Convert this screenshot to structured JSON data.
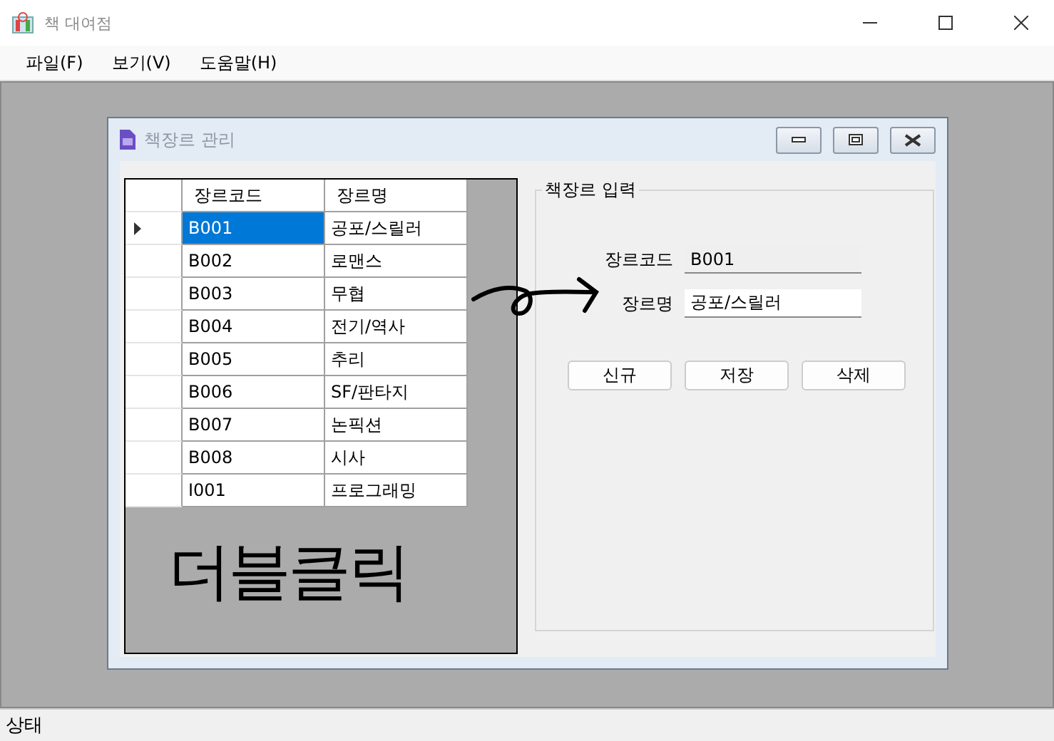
{
  "window": {
    "title": "책 대여점"
  },
  "menu": [
    "파일(F)",
    "보기(V)",
    "도움말(H)"
  ],
  "child_window": {
    "title": "책장르 관리"
  },
  "grid": {
    "columns": [
      "장르코드",
      "장르명"
    ],
    "rows": [
      {
        "cells": [
          "B001",
          "공포/스릴러"
        ],
        "selected": true
      },
      {
        "cells": [
          "B002",
          "로맨스"
        ],
        "selected": false
      },
      {
        "cells": [
          "B003",
          "무협"
        ],
        "selected": false
      },
      {
        "cells": [
          "B004",
          "전기/역사"
        ],
        "selected": false
      },
      {
        "cells": [
          "B005",
          "추리"
        ],
        "selected": false
      },
      {
        "cells": [
          "B006",
          "SF/판타지"
        ],
        "selected": false
      },
      {
        "cells": [
          "B007",
          "논픽션"
        ],
        "selected": false
      },
      {
        "cells": [
          "B008",
          "시사"
        ],
        "selected": false
      },
      {
        "cells": [
          "I001",
          "프로그래밍"
        ],
        "selected": false
      }
    ]
  },
  "form": {
    "title": "책장르 입력",
    "fields": [
      {
        "label": "장르코드",
        "value": "B001",
        "disabled": true
      },
      {
        "label": "장르명",
        "value": "공포/스릴러",
        "disabled": false
      }
    ],
    "buttons": [
      "신규",
      "저장",
      "삭제"
    ]
  },
  "annotation": {
    "text": "더블클릭"
  },
  "status_bar": "상태"
}
